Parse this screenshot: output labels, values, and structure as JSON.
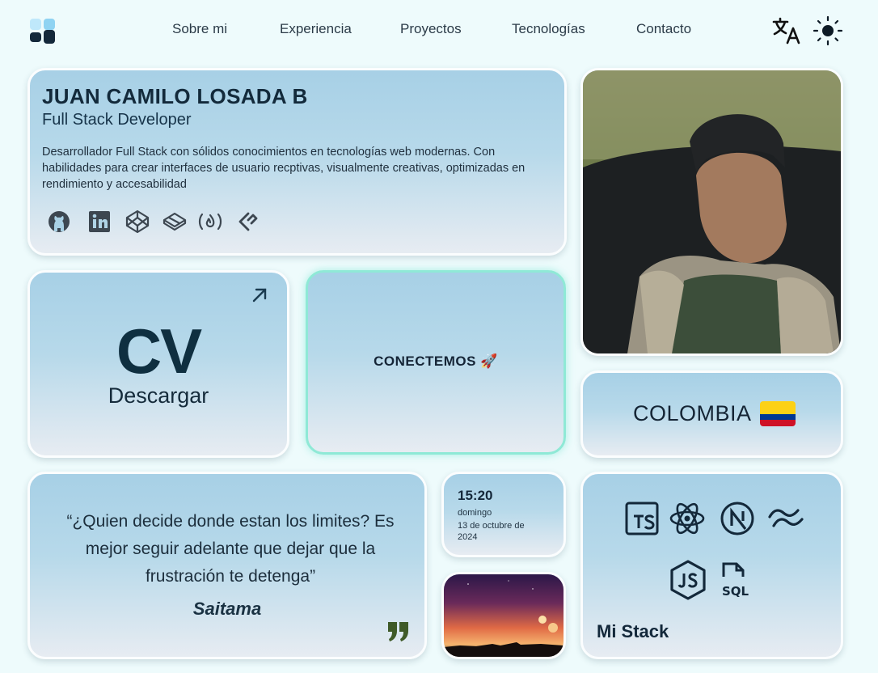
{
  "nav": {
    "links": [
      "Sobre mi",
      "Experiencia",
      "Proyectos",
      "Tecnologías",
      "Contacto"
    ],
    "icons": [
      "logo-icon",
      "translate-icon",
      "sun-icon"
    ]
  },
  "profile": {
    "name": "JUAN CAMILO LOSADA B",
    "role": "Full Stack Developer",
    "description": "Desarrollador Full Stack con sólidos conocimientos en tecnologías web modernas. Con habilidades para crear interfaces de usuario recptivas, visualmente creativas, optimizadas en rendimiento y accesabilidad",
    "socials": [
      "github-icon",
      "linkedin-icon",
      "codepen-icon",
      "codesandbox-icon",
      "freecodecamp-icon",
      "frontend-mentor-icon"
    ]
  },
  "cv": {
    "big": "CV",
    "label": "Descargar"
  },
  "connect": {
    "label": "CONECTEMOS 🚀"
  },
  "country": {
    "label": "COLOMBIA"
  },
  "quote": {
    "text": "“¿Quien decide donde estan los limites? Es mejor seguir adelante que dejar que la frustración te detenga”",
    "author": "Saitama"
  },
  "clock": {
    "time": "15:20",
    "day": "domingo",
    "date": "13 de octubre de 2024"
  },
  "stack": {
    "label": "Mi Stack",
    "icons": [
      "typescript-icon",
      "react-icon",
      "nextjs-icon",
      "tailwind-icon",
      "nodejs-icon",
      "sql-icon"
    ]
  },
  "colors": {
    "background": "#eefbfc",
    "card_top": "#a7d0e6",
    "card_bottom": "#e7ecf2",
    "connect_border": "#8fe9d6",
    "text_dark": "#13283a"
  }
}
